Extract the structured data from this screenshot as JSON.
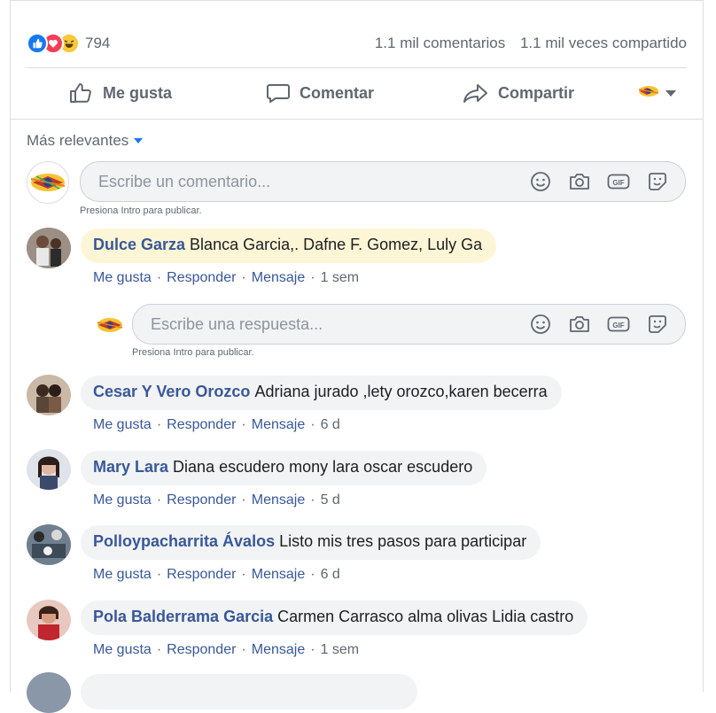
{
  "post": {
    "reactions": {
      "count": "794",
      "icons": [
        "like-icon",
        "love-icon",
        "haha-icon"
      ]
    },
    "stats": {
      "comments": "1.1 mil comentarios",
      "shares": "1.1 mil veces compartido"
    },
    "actions": {
      "like": "Me gusta",
      "comment": "Comentar",
      "share": "Compartir"
    }
  },
  "sort": {
    "label": "Más relevantes"
  },
  "composer": {
    "placeholder": "Escribe un comentario...",
    "hint": "Presiona Intro para publicar."
  },
  "reply_composer": {
    "placeholder": "Escribe una respuesta...",
    "hint": "Presiona Intro para publicar."
  },
  "meta_labels": {
    "like": "Me gusta",
    "reply": "Responder",
    "message": "Mensaje"
  },
  "comments": [
    {
      "name": "Dulce Garza",
      "text": "Blanca Garcia,. Dafne F. Gomez, Luly Ga",
      "time": "1 sem",
      "highlighted": true
    },
    {
      "name": "Cesar Y Vero Orozco",
      "text": "Adriana jurado ,lety orozco,karen becerra",
      "time": "6 d"
    },
    {
      "name": "Mary Lara",
      "text": "Diana escudero mony lara oscar escudero",
      "time": "5 d"
    },
    {
      "name": "Polloypacharrita Ávalos",
      "text": "Listo mis tres pasos para participar",
      "time": "6 d"
    },
    {
      "name": "Pola Balderrama Garcia",
      "text": "Carmen Carrasco alma olivas Lidia castro",
      "time": "1 sem"
    }
  ],
  "colors": {
    "link": "#385898",
    "accent": "#1877f2",
    "muted": "#606770",
    "highlight": "#fdf6d6"
  }
}
